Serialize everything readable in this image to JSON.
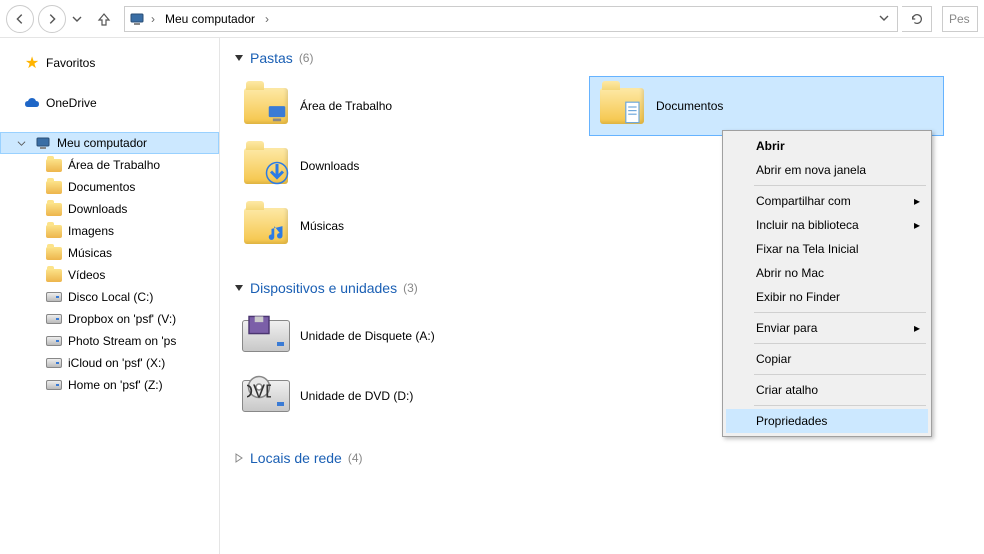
{
  "toolbar": {
    "address_location": "Meu computador",
    "search_placeholder": "Pes"
  },
  "sidebar": {
    "favorites": "Favoritos",
    "onedrive": "OneDrive",
    "computer": "Meu computador",
    "children": [
      "Área de Trabalho",
      "Documentos",
      "Downloads",
      "Imagens",
      "Músicas",
      "Vídeos",
      "Disco Local (C:)",
      "Dropbox on 'psf' (V:)",
      "Photo Stream on 'ps",
      "iCloud on 'psf' (X:)",
      "Home on 'psf' (Z:)"
    ]
  },
  "groups": {
    "folders": {
      "title": "Pastas",
      "count": "(6)"
    },
    "devices": {
      "title": "Dispositivos e unidades",
      "count": "(3)"
    },
    "network": {
      "title": "Locais de rede",
      "count": "(4)"
    }
  },
  "tiles": {
    "desktop": "Área de Trabalho",
    "documents": "Documentos",
    "downloads": "Downloads",
    "music": "Músicas",
    "floppy": "Unidade de Disquete (A:)",
    "dvd": "Unidade de DVD (D:)"
  },
  "context_menu": {
    "open": "Abrir",
    "open_new": "Abrir em nova janela",
    "share": "Compartilhar com",
    "library": "Incluir na biblioteca",
    "pin_start": "Fixar na Tela Inicial",
    "open_mac": "Abrir no Mac",
    "show_finder": "Exibir no Finder",
    "send_to": "Enviar para",
    "copy": "Copiar",
    "shortcut": "Criar atalho",
    "properties": "Propriedades"
  }
}
